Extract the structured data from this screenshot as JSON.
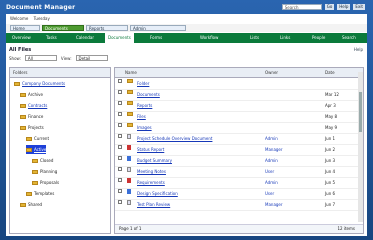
{
  "app": {
    "title": "Document Manager",
    "search_placeholder": "Search",
    "go_label": "Go",
    "help_label": "Help",
    "exit_label": "Exit"
  },
  "menu": {
    "user_label": "Welcome",
    "date_label": "Tuesday"
  },
  "tabs": [
    {
      "label": "Home"
    },
    {
      "label": "Documents"
    },
    {
      "label": "Reports"
    },
    {
      "label": "Admin"
    }
  ],
  "nav": [
    {
      "label": "Overview"
    },
    {
      "label": "Tasks"
    },
    {
      "label": "Calendar"
    },
    {
      "label": "Documents"
    },
    {
      "label": "Forms"
    },
    {
      "label": "Workflow"
    },
    {
      "label": "Lists"
    },
    {
      "label": "Links"
    },
    {
      "label": "People"
    },
    {
      "label": "Search"
    }
  ],
  "section": {
    "title": "All Files",
    "right_label": "Help"
  },
  "filter": {
    "label": "Show:",
    "value": "All",
    "view_label": "View:",
    "view_value": "Detail"
  },
  "tree": {
    "header": "Folders",
    "items": [
      {
        "label": "Company Documents",
        "indent": 0
      },
      {
        "label": "Archive",
        "indent": 1
      },
      {
        "label": "Contracts",
        "indent": 1
      },
      {
        "label": "Finance",
        "indent": 1
      },
      {
        "label": "Projects",
        "indent": 1
      },
      {
        "label": "Current",
        "indent": 2
      },
      {
        "label": "Active",
        "indent": 2
      },
      {
        "label": "Closed",
        "indent": 3
      },
      {
        "label": "Planning",
        "indent": 3
      },
      {
        "label": "Proposals",
        "indent": 3
      },
      {
        "label": "Templates",
        "indent": 2
      },
      {
        "label": "Shared",
        "indent": 1
      }
    ]
  },
  "grid": {
    "header_name": "Name",
    "header_owner": "Owner",
    "header_date": "Date",
    "rows": [
      {
        "name": "Folder",
        "owner": "",
        "date": ""
      },
      {
        "name": "Documents",
        "owner": "",
        "date": "Mar 12"
      },
      {
        "name": "Reports",
        "owner": "",
        "date": "Apr 3"
      },
      {
        "name": "Files",
        "owner": "",
        "date": "May 8"
      },
      {
        "name": "Images",
        "owner": "",
        "date": "May 9"
      },
      {
        "name": "Project Schedule Overview Document",
        "owner": "Admin",
        "date": "Jun 1"
      },
      {
        "name": "Status Report",
        "owner": "Manager",
        "date": "Jun 2"
      },
      {
        "name": "Budget Summary",
        "owner": "Admin",
        "date": "Jun 3"
      },
      {
        "name": "Meeting Notes",
        "owner": "User",
        "date": "Jun 4"
      },
      {
        "name": "Requirements",
        "owner": "Admin",
        "date": "Jun 5"
      },
      {
        "name": "Design Specification",
        "owner": "User",
        "date": "Jun 6"
      },
      {
        "name": "Test Plan Review",
        "owner": "Manager",
        "date": "Jun 7"
      }
    ],
    "pager_left": "Page 1 of 1",
    "pager_right": "12 items"
  }
}
